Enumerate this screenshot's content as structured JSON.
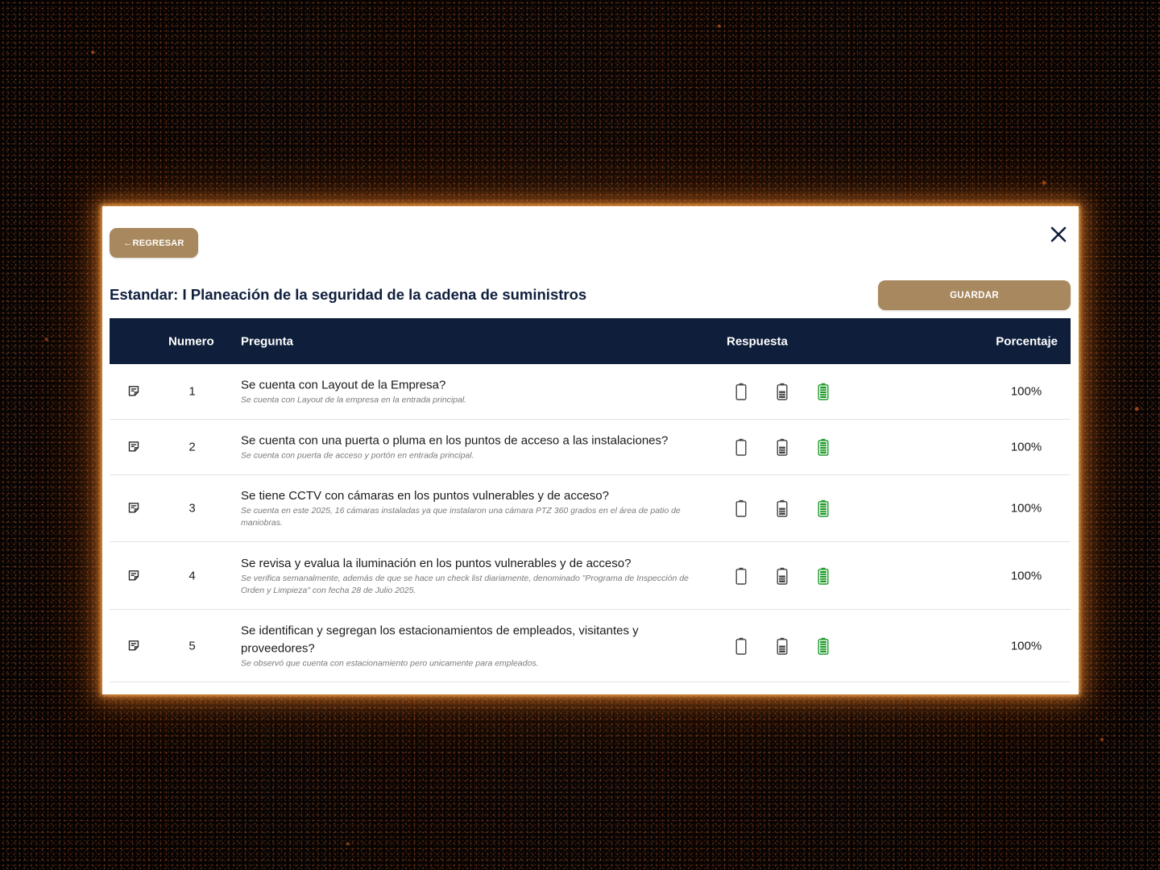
{
  "modal": {
    "back_label": "←REGRESAR",
    "close_icon": "close-icon",
    "title": "Estandar: I Planeación de la seguridad de la cadena de suministros",
    "save_label": "GUARDAR"
  },
  "colors": {
    "accent_button": "#a8885e",
    "header_bg": "#0f1f3b",
    "title_text": "#0f1f3d",
    "battery_full": "#1f9a2a",
    "battery_inactive": "#444444",
    "glow": "#f08a2e"
  },
  "table": {
    "headers": {
      "numero": "Numero",
      "pregunta": "Pregunta",
      "respuesta": "Respuesta",
      "porcentaje": "Porcentaje"
    },
    "response_icons": [
      "battery-empty-icon",
      "battery-half-icon",
      "battery-full-icon"
    ],
    "rows": [
      {
        "numero": "1",
        "pregunta": "Se cuenta con Layout de la Empresa?",
        "observacion": "Se cuenta con Layout de la empresa en la entrada principal.",
        "selected_response": "battery-full",
        "porcentaje": "100%"
      },
      {
        "numero": "2",
        "pregunta": "Se cuenta con una puerta o pluma en los puntos de acceso a las instalaciones?",
        "observacion": "Se cuenta con puerta de acceso y portón en entrada principal.",
        "selected_response": "battery-full",
        "porcentaje": "100%"
      },
      {
        "numero": "3",
        "pregunta": "Se tiene CCTV con cámaras en los puntos vulnerables y de acceso?",
        "observacion": "Se cuenta en este 2025, 16 cámaras instaladas ya que instalaron una cámara PTZ 360 grados en el área de patio de maniobras.",
        "selected_response": "battery-full",
        "porcentaje": "100%"
      },
      {
        "numero": "4",
        "pregunta": "Se revisa y evalua la iluminación en los puntos vulnerables y de acceso?",
        "observacion": "Se verifica semanalmente, además de que se hace un check list diariamente, denominado \"Programa de Inspección de Orden y Limpieza\" con fecha 28 de Julio 2025.",
        "selected_response": "battery-full",
        "porcentaje": "100%"
      },
      {
        "numero": "5",
        "pregunta": "Se identifican y segregan los estacionamientos de empleados, visitantes y proveedores?",
        "observacion": "Se observó que cuenta con estacionamiento pero unicamente para empleados.",
        "selected_response": "battery-full",
        "porcentaje": "100%"
      }
    ]
  }
}
